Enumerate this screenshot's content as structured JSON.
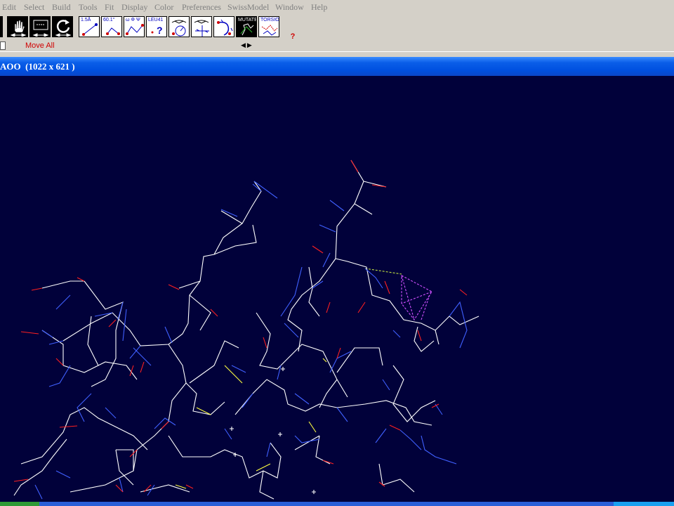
{
  "menu": [
    "Edit",
    "Select",
    "Build",
    "Tools",
    "Fit",
    "Display",
    "Color",
    "Preferences",
    "SwissModel",
    "Window",
    "Help"
  ],
  "toolbar": {
    "buttons": [
      {
        "name": "distance-button",
        "label": "1.5Å"
      },
      {
        "name": "angle-button",
        "label": "60.1°"
      },
      {
        "name": "torsion-angle-button",
        "label": "ω Φ Ψ"
      },
      {
        "name": "label-button",
        "label": "LEU41"
      },
      {
        "name": "center-atom-button",
        "label": ""
      },
      {
        "name": "center-view-button",
        "label": ""
      },
      {
        "name": "fit-button",
        "label": ""
      },
      {
        "name": "mutate-button",
        "label": "MUTATE"
      },
      {
        "name": "torsion-button",
        "label": "TORSION"
      }
    ],
    "help": "?"
  },
  "status": {
    "mode": "Move All",
    "arrows": "◀▶"
  },
  "window": {
    "title": "AOO  (1022 x 621 )"
  },
  "colors": {
    "viewport_bg": "#01013a",
    "bond_white": "#ffffff",
    "bond_blue": "#4060ff",
    "bond_red": "#ff2020",
    "bond_yellow": "#ffff40",
    "hbond_magenta": "#d050ff",
    "title_blue": "#0054e3"
  }
}
